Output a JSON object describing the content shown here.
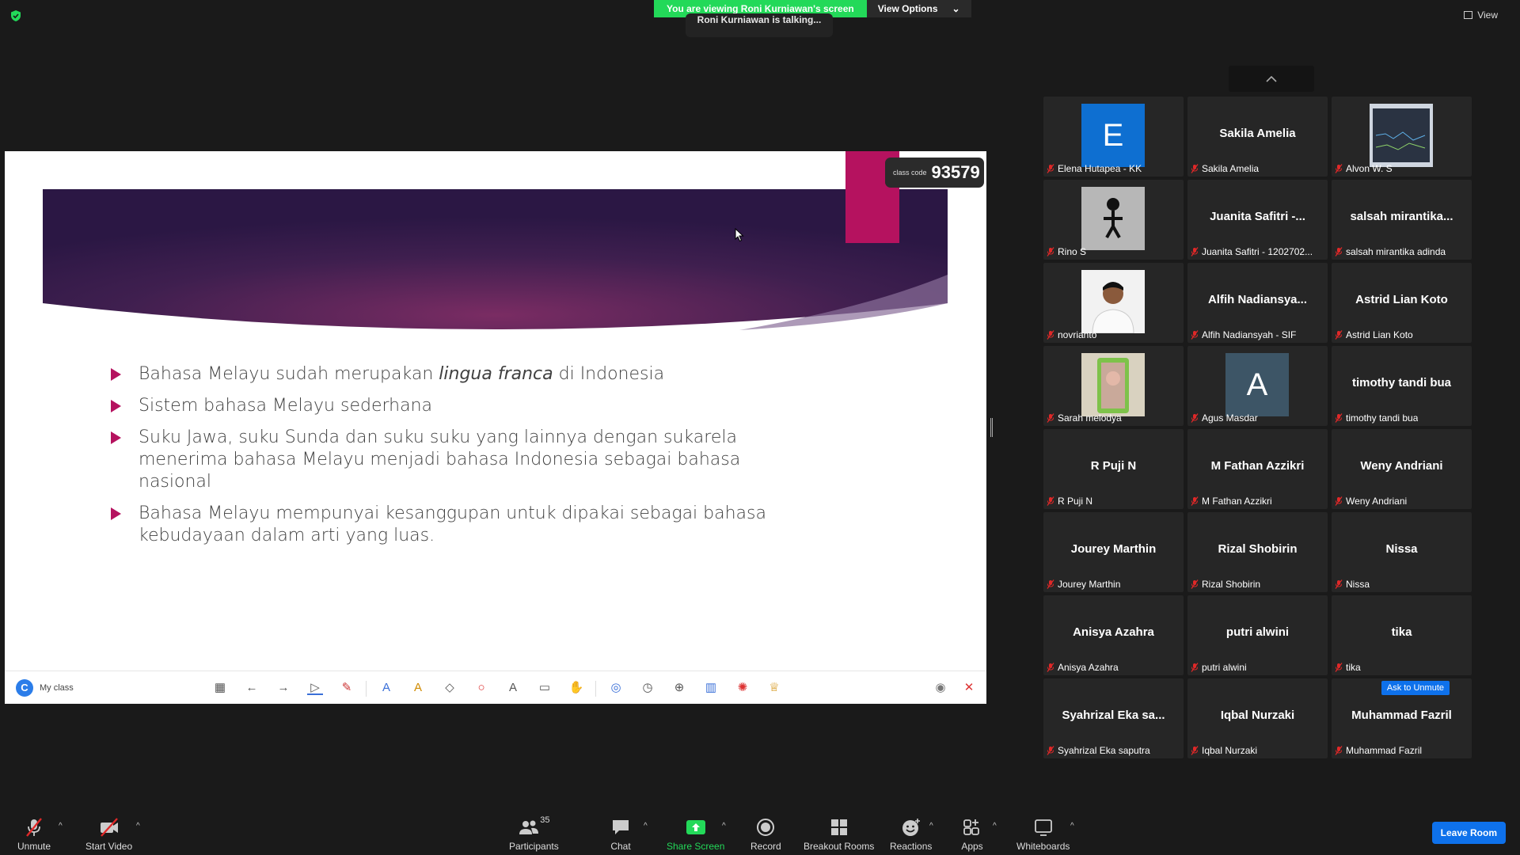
{
  "banner": {
    "viewing": "You are viewing Roni Kurniawan's screen",
    "view_options": "View Options",
    "talking": "Roni Kurniawan is talking..."
  },
  "top_right": {
    "view": "View"
  },
  "slide": {
    "class_code_label": "class code",
    "class_code": "93579",
    "bullets": [
      {
        "pre": "Bahasa Melayu sudah merupakan ",
        "em": "lingua franca",
        "post": " di Indonesia"
      },
      {
        "pre": "Sistem bahasa Melayu sederhana",
        "em": "",
        "post": ""
      },
      {
        "pre": "Suku Jawa, suku Sunda dan suku suku yang lainnya dengan sukarela menerima bahasa Melayu menjadi bahasa Indonesia sebagai bahasa nasional",
        "em": "",
        "post": ""
      },
      {
        "pre": "Bahasa Melayu mempunyai kesanggupan untuk dipakai sebagai bahasa kebudayaan dalam arti yang luas.",
        "em": "",
        "post": ""
      }
    ]
  },
  "whiteboard_bar": {
    "brand": "My class"
  },
  "participants": [
    {
      "big": "",
      "name": "Elena Hutapea - KK",
      "avatar": "letter",
      "letter": "E",
      "avatar_color": "#0e6fd1"
    },
    {
      "big": "Sakila Amelia",
      "name": "Sakila Amelia",
      "avatar": "none"
    },
    {
      "big": "",
      "name": "Alvon W. S",
      "avatar": "screen"
    },
    {
      "big": "",
      "name": "Rino S",
      "avatar": "figure"
    },
    {
      "big": "Juanita Safitri -...",
      "name": "Juanita Safitri - 1202702...",
      "avatar": "none"
    },
    {
      "big": "salsah  mirantika...",
      "name": "salsah mirantika adinda",
      "avatar": "none"
    },
    {
      "big": "",
      "name": "novrianto",
      "avatar": "person"
    },
    {
      "big": "Alfih  Nadiansya...",
      "name": "Alfih Nadiansyah - SIF",
      "avatar": "none"
    },
    {
      "big": "Astrid Lian Koto",
      "name": "Astrid Lian Koto",
      "avatar": "none"
    },
    {
      "big": "",
      "name": "Sarah melodya",
      "avatar": "photo"
    },
    {
      "big": "",
      "name": "Agus Masdar",
      "avatar": "letter",
      "letter": "A",
      "avatar_color": "#3d5566"
    },
    {
      "big": "timothy tandi bua",
      "name": "timothy tandi bua",
      "avatar": "none"
    },
    {
      "big": "R Puji N",
      "name": "R Puji N",
      "avatar": "none"
    },
    {
      "big": "M Fathan Azzikri",
      "name": "M Fathan Azzikri",
      "avatar": "none"
    },
    {
      "big": "Weny Andriani",
      "name": "Weny Andriani",
      "avatar": "none"
    },
    {
      "big": "Jourey Marthin",
      "name": "Jourey Marthin",
      "avatar": "none"
    },
    {
      "big": "Rizal Shobirin",
      "name": "Rizal Shobirin",
      "avatar": "none"
    },
    {
      "big": "Nissa",
      "name": "Nissa",
      "avatar": "none"
    },
    {
      "big": "Anisya Azahra",
      "name": "Anisya Azahra",
      "avatar": "none"
    },
    {
      "big": "putri alwini",
      "name": "putri alwini",
      "avatar": "none"
    },
    {
      "big": "tika",
      "name": "tika",
      "avatar": "none"
    },
    {
      "big": "Syahrizal  Eka sa...",
      "name": "Syahrizal Eka saputra",
      "avatar": "none"
    },
    {
      "big": "Iqbal Nurzaki",
      "name": "Iqbal Nurzaki",
      "avatar": "none"
    },
    {
      "big": "Muhammad Fazril",
      "name": "Muhammad Fazril",
      "avatar": "none",
      "ask_unmute": "Ask to Unmute"
    }
  ],
  "toolbar": {
    "unmute": "Unmute",
    "start_video": "Start Video",
    "participants": "Participants",
    "participants_count": "35",
    "chat": "Chat",
    "share_screen": "Share Screen",
    "record": "Record",
    "breakout_rooms": "Breakout Rooms",
    "reactions": "Reactions",
    "apps": "Apps",
    "whiteboards": "Whiteboards",
    "leave_room": "Leave Room"
  },
  "colors": {
    "share_green": "#23d959",
    "accent_blue": "#0e71eb",
    "slide_pink": "#b5125f",
    "mute_red": "#e02828"
  }
}
